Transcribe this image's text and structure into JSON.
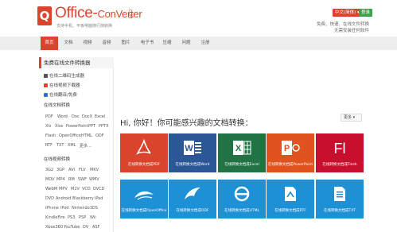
{
  "header": {
    "logo_letter": "Q",
    "logo_text_a": "Office-",
    "logo_text_b": "ConVerter",
    "logo_com": ".COM",
    "tagline_small": "支持手机、平板电脑随行随转换",
    "lang_button": "中文(简体) ▾",
    "login_button": "登录",
    "tagline_1": "免费、快速、在线文件转换",
    "tagline_2": "无需安装任何软件"
  },
  "nav": [
    "首页",
    "文档",
    "视频",
    "音频",
    "图片",
    "电子书",
    "压缩",
    "问题",
    "注册"
  ],
  "sidebar": {
    "heading": "免费在线文件转换器",
    "links": [
      "在线二维码生成器",
      "在线视频下载器",
      "在线翻译/免费"
    ],
    "doc_title": "在线文档转换",
    "doc_formats": [
      [
        "PDF",
        "Word",
        "Doc",
        "DocX",
        "Excel"
      ],
      [
        "Xls",
        "Xlsx",
        "PowerPoint",
        "PPT",
        "PPTX"
      ],
      [
        "Flash",
        "OpenOffice",
        "HTML",
        "ODF"
      ],
      [
        "RTF",
        "TXT",
        "XML",
        "更多..."
      ]
    ],
    "video_title": "在线视频转换",
    "video_formats": [
      [
        "3G2",
        "3GP",
        "AVI",
        "FLV",
        "MKV"
      ],
      [
        "MOV",
        "MP4",
        "RM",
        "SWF",
        "WMV"
      ],
      [
        "WebM",
        "MPV",
        "M2V",
        "VCD",
        "DVCD"
      ],
      [
        "DVD",
        "Android",
        "Blackberry",
        "iPad"
      ],
      [
        "iPhone",
        "iPod",
        "Nintendo3DS"
      ],
      [
        "KindleFire",
        "PS3",
        "PSP",
        "Wii"
      ],
      [
        "Xbox360",
        "YouTube",
        "DV",
        "ASF"
      ]
    ]
  },
  "main": {
    "greeting": "Hi, 你好！你可能感兴趣的文档转换：",
    "more_button": "更多 ▾",
    "tiles": [
      {
        "label": "在线转换文档成PDF",
        "icon": "pdf-icon",
        "color": "#d8442c"
      },
      {
        "label": "在线转换文档成Word",
        "icon": "word-icon",
        "color": "#2b5797"
      },
      {
        "label": "在线转换文档成Excel",
        "icon": "excel-icon",
        "color": "#217346"
      },
      {
        "label": "在线转换文档成PowerPoint",
        "icon": "powerpoint-icon",
        "color": "#e0531f"
      },
      {
        "label": "在线转换文档成Flash",
        "icon": "flash-icon",
        "color": "#c8102e"
      },
      {
        "label": "在线转换文档成OpenOffice",
        "icon": "openoffice-icon",
        "color": "#1e90d6"
      },
      {
        "label": "在线转换文档成ODF",
        "icon": "odf-icon",
        "color": "#1e90d6"
      },
      {
        "label": "在线转换文档成HTML",
        "icon": "html-icon",
        "color": "#1e90d6"
      },
      {
        "label": "在线转换文档成RTF",
        "icon": "rtf-icon",
        "color": "#1e90d6"
      },
      {
        "label": "在线转换文档成TXT",
        "icon": "txt-icon",
        "color": "#1e90d6"
      }
    ]
  }
}
